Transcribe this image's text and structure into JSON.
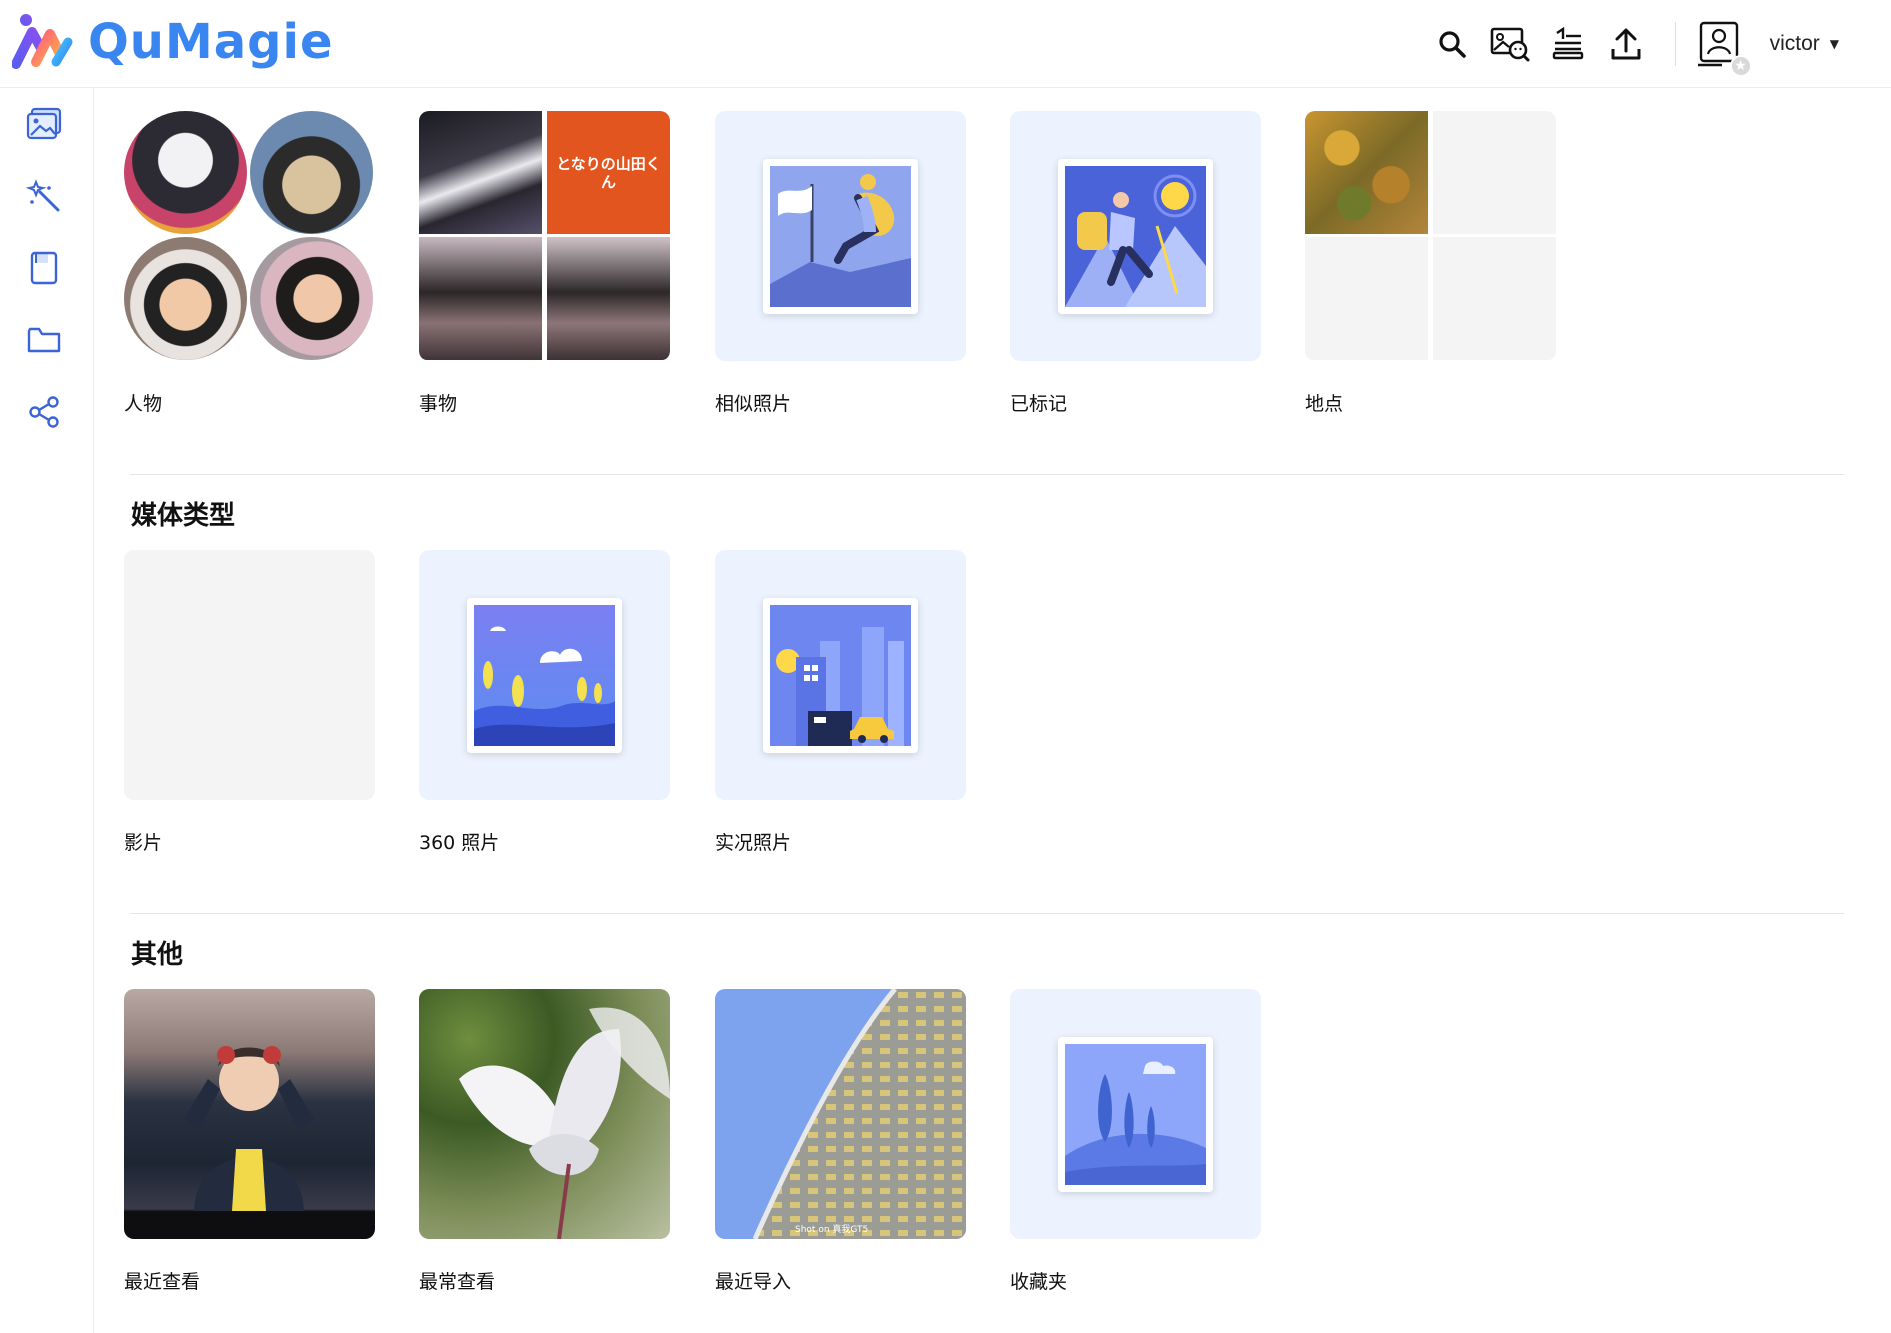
{
  "app": {
    "name": "QuMagie"
  },
  "header": {
    "icons": [
      "search-icon",
      "image-search-icon",
      "task-list-icon",
      "upload-icon"
    ],
    "user": {
      "name": "victor"
    }
  },
  "sidebar": {
    "items": [
      {
        "name": "photos-icon"
      },
      {
        "name": "magic-wand-icon"
      },
      {
        "name": "album-icon"
      },
      {
        "name": "folder-icon"
      },
      {
        "name": "share-icon"
      }
    ]
  },
  "smart_albums": [
    {
      "label": "人物"
    },
    {
      "label": "事物"
    },
    {
      "label": "相似照片"
    },
    {
      "label": "已标记"
    },
    {
      "label": "地点"
    }
  ],
  "media_types": {
    "title": "媒体类型",
    "items": [
      {
        "label": "影片"
      },
      {
        "label": "360 照片"
      },
      {
        "label": "实况照片"
      }
    ]
  },
  "others": {
    "title": "其他",
    "items": [
      {
        "label": "最近查看"
      },
      {
        "label": "最常查看"
      },
      {
        "label": "最近导入"
      },
      {
        "label": "收藏夹"
      }
    ]
  },
  "thumbnail_text": {
    "things_poster": "となりの山田くん",
    "recent_import_watermark": "Shot on 真我GT5"
  },
  "colors": {
    "accent": "#3a86f0",
    "card_bg": "#ecf3fe",
    "empty_bg": "#f4f4f5"
  }
}
